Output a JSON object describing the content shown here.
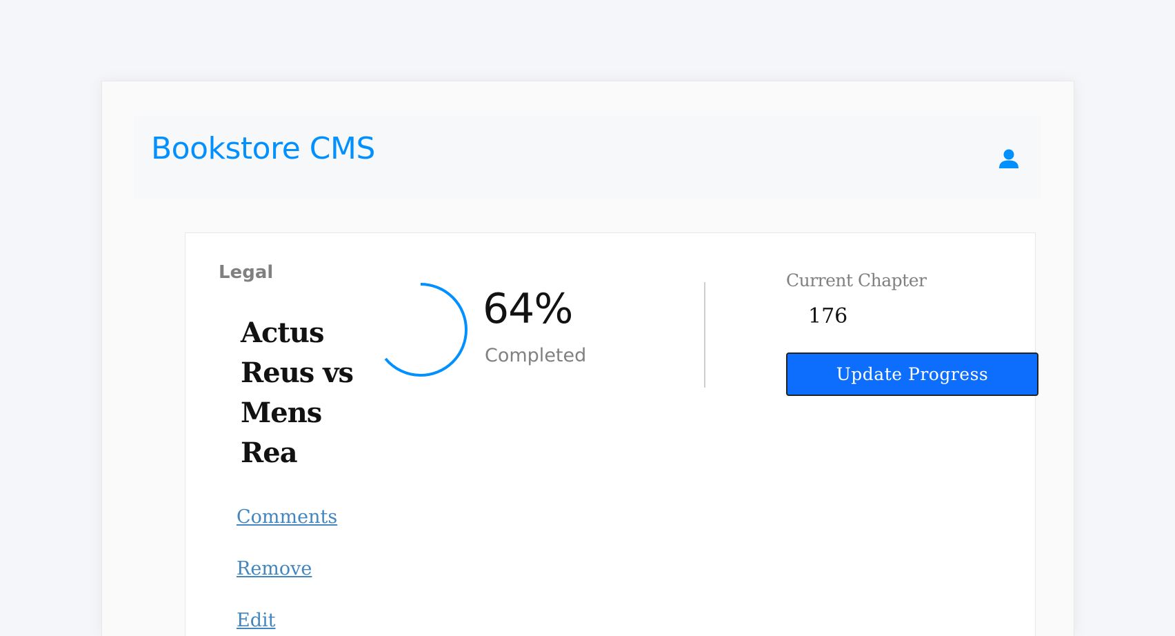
{
  "app": {
    "title": "Bookstore CMS"
  },
  "colors": {
    "brand": "#0290ff",
    "button": "#0d6efd",
    "link": "#4386bf"
  },
  "header": {
    "user_icon": "user-icon"
  },
  "book": {
    "category": "Legal",
    "title": "Actus Reus vs Mens Rea",
    "actions": {
      "comments": "Comments",
      "remove": "Remove",
      "edit": "Edit"
    },
    "progress": {
      "percent": 64,
      "percent_label": "64%",
      "status": "Completed"
    },
    "chapter": {
      "label": "Current Chapter",
      "value": "176"
    },
    "update_button": "Update Progress"
  }
}
